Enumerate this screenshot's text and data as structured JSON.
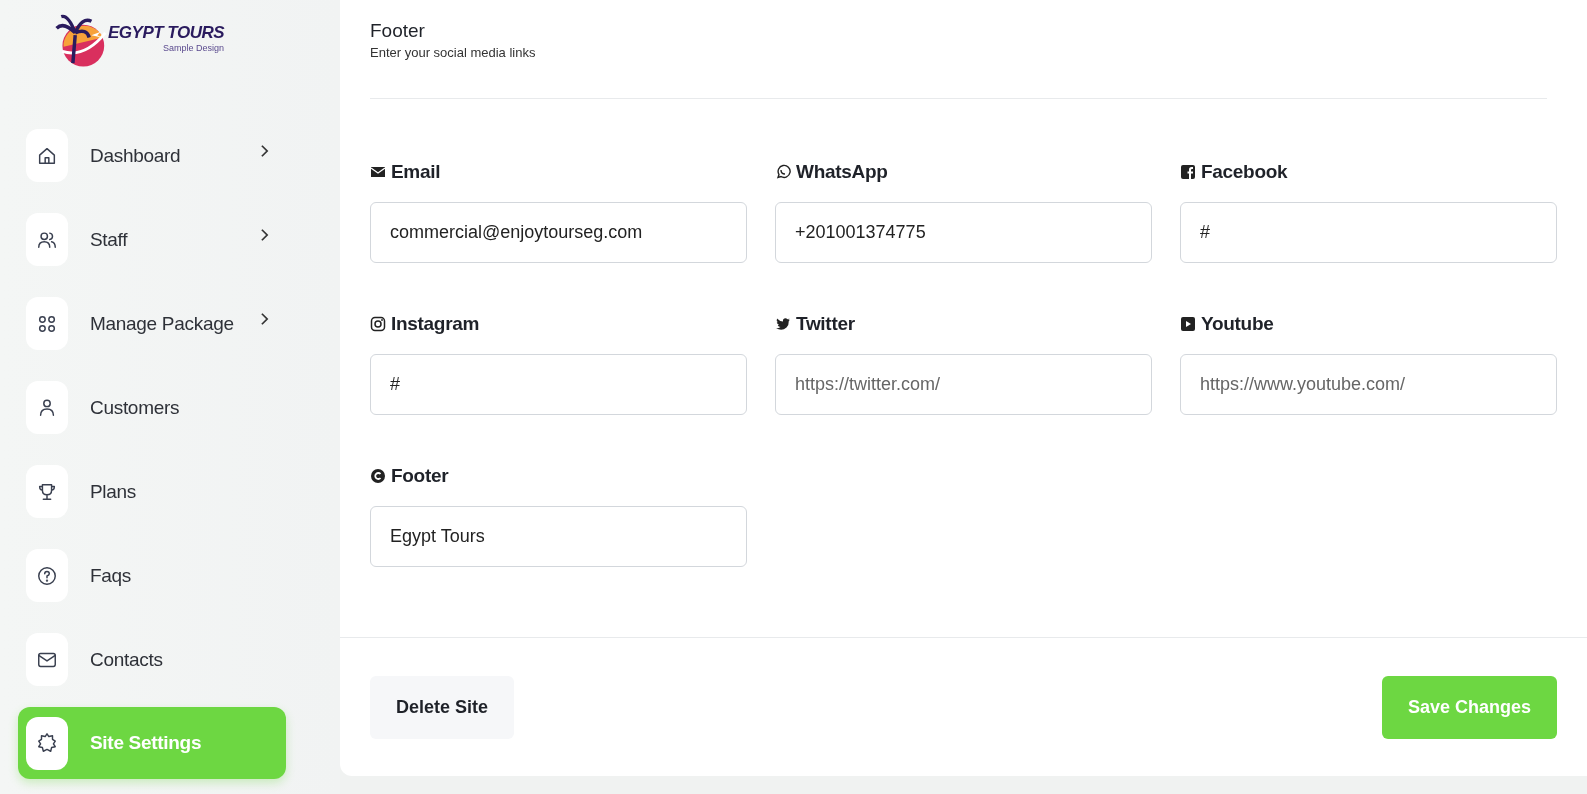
{
  "logo": {
    "title": "EGYPT TOURS",
    "subtitle": "Sample Design"
  },
  "sidebar": {
    "items": [
      {
        "label": "Dashboard",
        "submenu": true,
        "selected": false
      },
      {
        "label": "Staff",
        "submenu": true,
        "selected": false
      },
      {
        "label": "Manage Package",
        "submenu": true,
        "selected": false
      },
      {
        "label": "Customers",
        "submenu": false,
        "selected": false
      },
      {
        "label": "Plans",
        "submenu": false,
        "selected": false
      },
      {
        "label": "Faqs",
        "submenu": false,
        "selected": false
      },
      {
        "label": "Contacts",
        "submenu": false,
        "selected": false
      },
      {
        "label": "Site Settings",
        "submenu": false,
        "selected": true
      }
    ]
  },
  "section": {
    "title": "Footer",
    "subtitle": "Enter your social media links"
  },
  "fields": [
    {
      "kind": "email",
      "label": "Email",
      "value": "commercial@enjoytourseg.com"
    },
    {
      "kind": "whatsapp",
      "label": "WhatsApp",
      "value": "+201001374775"
    },
    {
      "kind": "facebook",
      "label": "Facebook",
      "value": "#"
    },
    {
      "kind": "instagram",
      "label": "Instagram",
      "value": "#"
    },
    {
      "kind": "twitter",
      "label": "Twitter",
      "placeholder": "https://twitter.com/"
    },
    {
      "kind": "youtube",
      "label": "Youtube",
      "placeholder": "https://www.youtube.com/"
    },
    {
      "kind": "copyright",
      "label": "Footer",
      "value": "Egypt Tours"
    }
  ],
  "buttons": {
    "delete": "Delete Site",
    "save": "Save Changes"
  }
}
